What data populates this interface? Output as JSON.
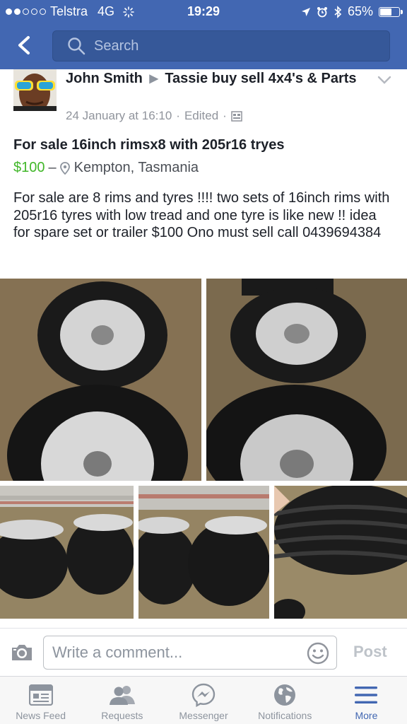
{
  "status_bar": {
    "carrier": "Telstra",
    "network": "4G",
    "time": "19:29",
    "battery": "65%",
    "battery_level": 0.65,
    "signal_bars_filled": 2,
    "signal_bars_total": 5
  },
  "nav": {
    "search_placeholder": "Search"
  },
  "post": {
    "author": "John Smith",
    "group": "Tassie buy sell 4x4's & Parts",
    "timestamp": "24 January at 16:10",
    "edited": "Edited",
    "separator": "·",
    "title": "For sale 16inch rimsx8 with 205r16 tryes",
    "price": "$100",
    "price_dash": "–",
    "location": "Kempton, Tasmania",
    "body": "For sale are 8 rims and tyres !!!!  two sets of 16inch rims with 205r16 tyres with low tread and one tyre is like new !! idea for spare set or trailer $100 Ono must sell call 0439694384",
    "photo_count": 5
  },
  "comment": {
    "placeholder": "Write a comment...",
    "post_label": "Post"
  },
  "tabs": [
    {
      "label": "News Feed",
      "icon": "news-feed-icon",
      "active": false
    },
    {
      "label": "Requests",
      "icon": "friend-requests-icon",
      "active": false
    },
    {
      "label": "Messenger",
      "icon": "messenger-icon",
      "active": false
    },
    {
      "label": "Notifications",
      "icon": "globe-icon",
      "active": false
    },
    {
      "label": "More",
      "icon": "menu-icon",
      "active": true
    }
  ],
  "colors": {
    "brand": "#4267b2",
    "price": "#42b72a",
    "muted": "#90949c"
  }
}
